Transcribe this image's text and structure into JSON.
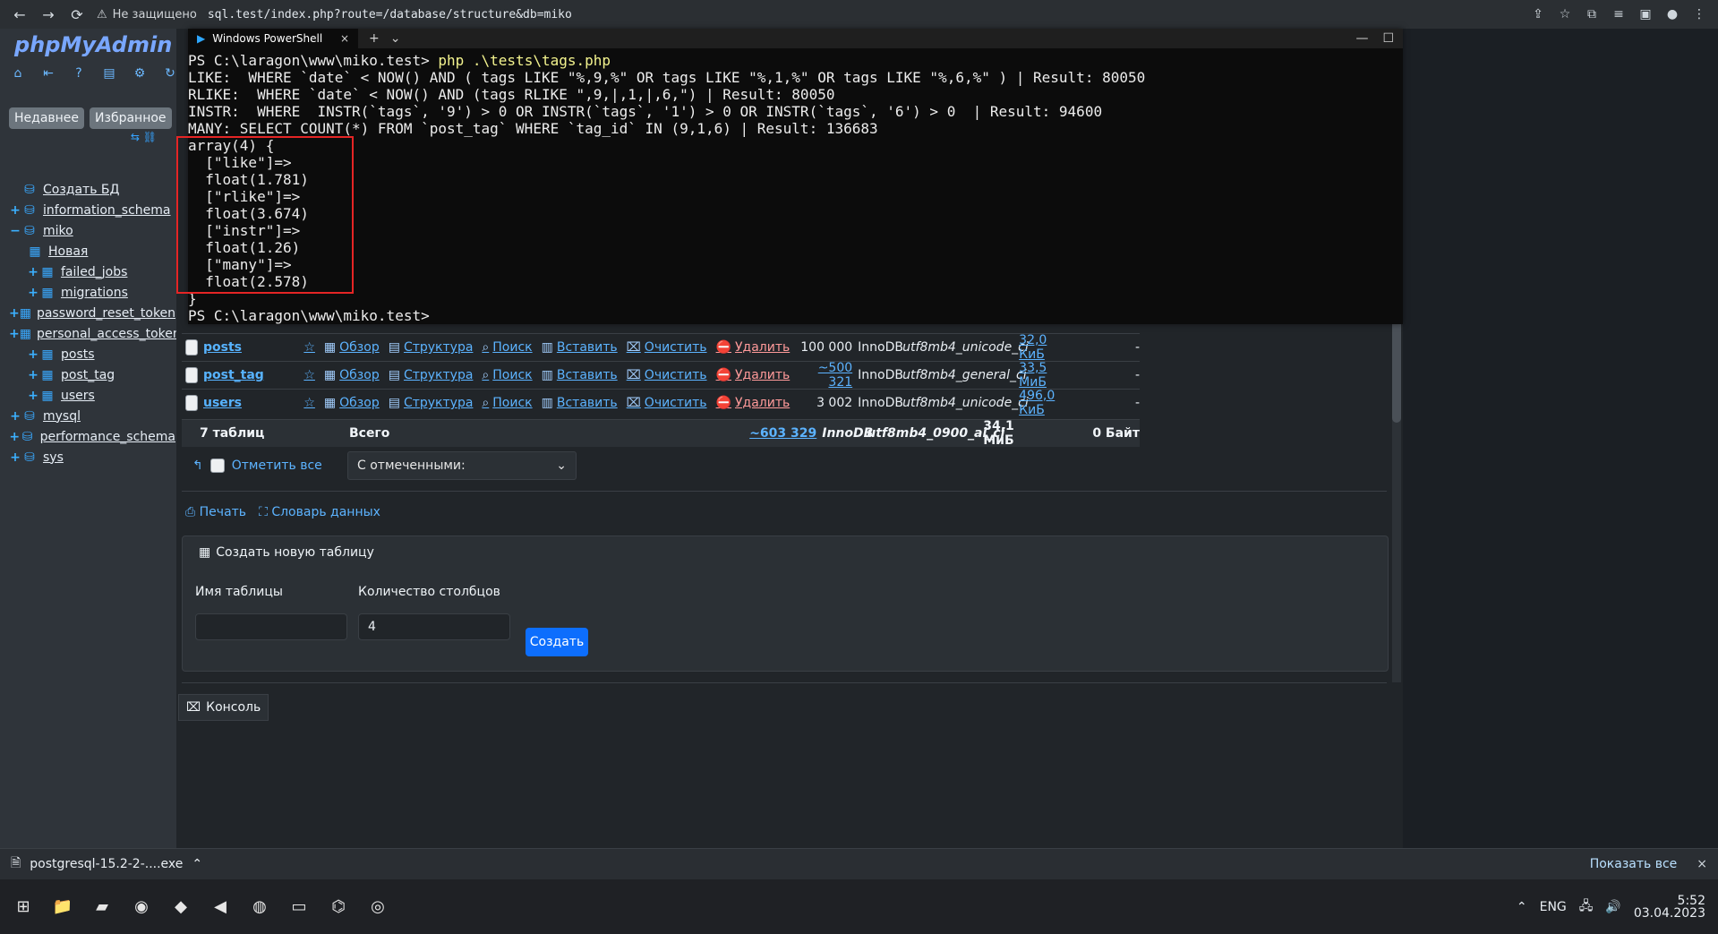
{
  "browser": {
    "security_label": "Не защищено",
    "url": "sql.test/index.php?route=/database/structure&db=miko"
  },
  "pma": {
    "logo": "phpMyAdmin",
    "tabs": {
      "recent": "Недавнее",
      "favorites": "Избранное"
    },
    "tree": {
      "create_db": "Создать БД",
      "databases": [
        {
          "name": "information_schema"
        },
        {
          "name": "miko",
          "children": [
            "Новая",
            "failed_jobs",
            "migrations",
            "password_reset_token",
            "personal_access_token",
            "posts",
            "post_tag",
            "users"
          ]
        },
        {
          "name": "mysql"
        },
        {
          "name": "performance_schema"
        },
        {
          "name": "sys"
        }
      ]
    }
  },
  "structure": {
    "actions": {
      "favorite": "☆",
      "browse": "Обзор",
      "structure": "Структура",
      "search": "Поиск",
      "insert": "Вставить",
      "empty": "Очистить",
      "drop": "Удалить"
    },
    "rows": [
      {
        "name": "posts",
        "rows": "100 000",
        "type": "InnoDB",
        "collation": "utf8mb4_unicode_ci",
        "size": "32,0 КиБ",
        "frag": "-"
      },
      {
        "name": "post_tag",
        "rows": "~500 321",
        "type": "InnoDB",
        "collation": "utf8mb4_general_ci",
        "size": "33,5 МиБ",
        "frag": "-"
      },
      {
        "name": "users",
        "rows": "3 002",
        "type": "InnoDB",
        "collation": "utf8mb4_unicode_ci",
        "size": "496,0 КиБ",
        "frag": "-"
      }
    ],
    "totals": {
      "label": "7 таблиц",
      "sum": "Всего",
      "rows": "~603 329",
      "type": "InnoDB",
      "collation": "utf8mb4_0900_ai_ci",
      "size": "34,1 МиБ",
      "frag": "0 Байт"
    },
    "check_all": "Отметить все",
    "with_selected": "С отмеченными:",
    "print": "Печать",
    "dictionary": "Словарь данных",
    "create_table": {
      "title": "Создать новую таблицу",
      "name_label": "Имя таблицы",
      "columns_label": "Количество столбцов",
      "columns_value": "4",
      "button": "Создать"
    },
    "console": "Консоль"
  },
  "powershell": {
    "tab_title": "Windows PowerShell",
    "lines": [
      {
        "prompt": "PS C:\\laragon\\www\\miko.test> ",
        "cmd": "php .\\tests\\tags.php"
      },
      {
        "text": "LIKE:  WHERE `date` < NOW() AND ( tags LIKE \"%,9,%\" OR tags LIKE \"%,1,%\" OR tags LIKE \"%,6,%\" ) | Result: 80050"
      },
      {
        "text": "RLIKE:  WHERE `date` < NOW() AND (tags RLIKE \",9,|,1,|,6,\") | Result: 80050"
      },
      {
        "text": "INSTR:  WHERE  INSTR(`tags`, '9') > 0 OR INSTR(`tags`, '1') > 0 OR INSTR(`tags`, '6') > 0  | Result: 94600"
      },
      {
        "text": "MANY: SELECT COUNT(*) FROM `post_tag` WHERE `tag_id` IN (9,1,6) | Result: 136683"
      },
      {
        "text": "array(4) {"
      },
      {
        "text": "  [\"like\"]=>"
      },
      {
        "text": "  float(1.781)"
      },
      {
        "text": "  [\"rlike\"]=>"
      },
      {
        "text": "  float(3.674)"
      },
      {
        "text": "  [\"instr\"]=>"
      },
      {
        "text": "  float(1.26)"
      },
      {
        "text": "  [\"many\"]=>"
      },
      {
        "text": "  float(2.578)"
      },
      {
        "text": "}"
      },
      {
        "prompt": "PS C:\\laragon\\www\\miko.test> ",
        "cmd": ""
      }
    ]
  },
  "downloadbar": {
    "file": "postgresql-15.2-2-....exe",
    "show_all": "Показать все"
  },
  "taskbar": {
    "lang": "ENG",
    "time": "5:52",
    "date": "03.04.2023"
  }
}
